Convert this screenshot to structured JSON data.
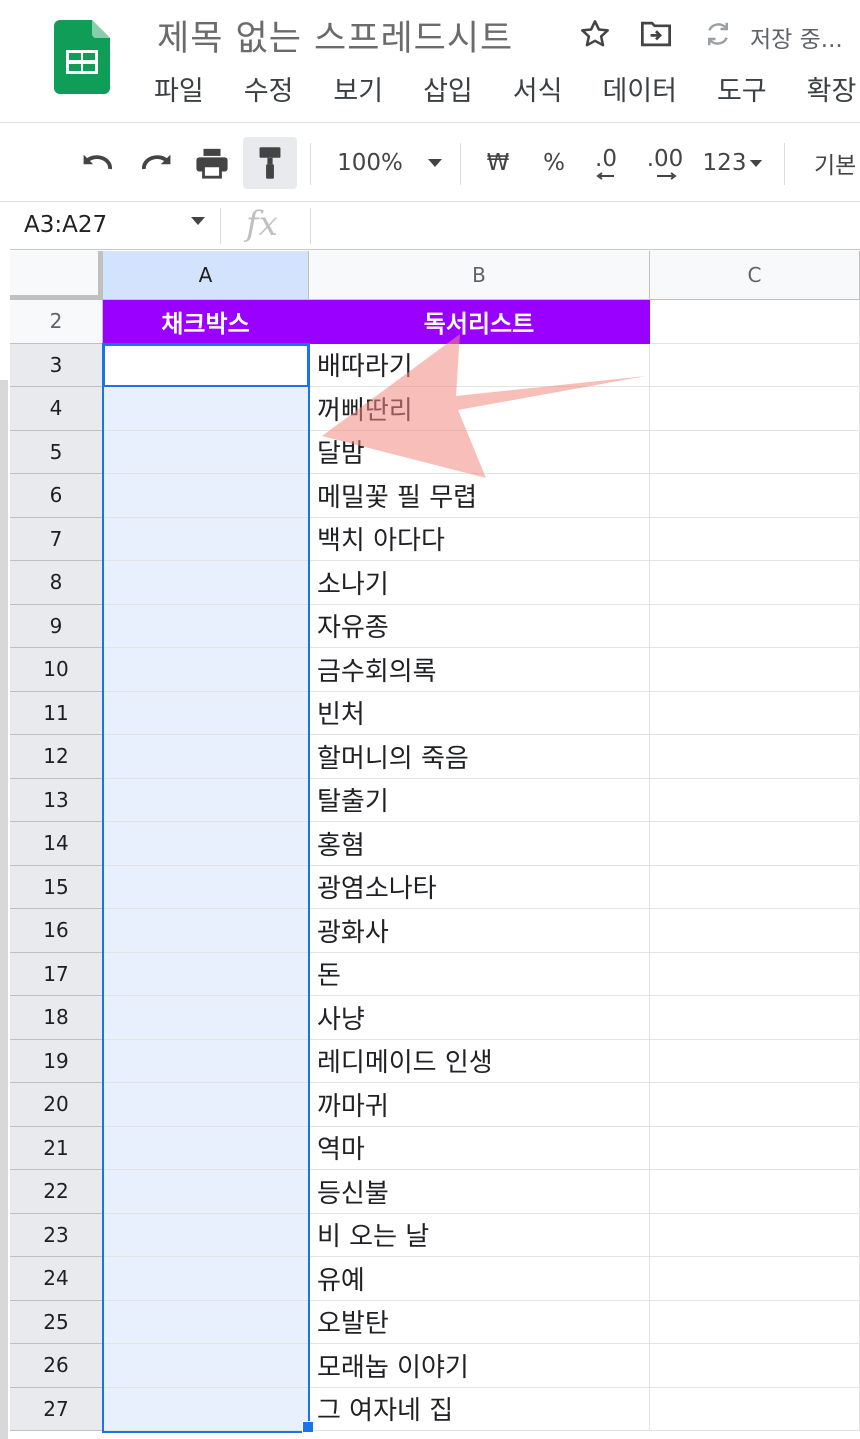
{
  "header": {
    "title": "제목 없는 스프레드시트",
    "save_status": "저장 중..."
  },
  "menu": [
    "파일",
    "수정",
    "보기",
    "삽입",
    "서식",
    "데이터",
    "도구",
    "확장 프"
  ],
  "toolbar": {
    "zoom": "100%",
    "currency": "₩",
    "percent": "%",
    "decrease_decimal": ".0",
    "increase_decimal": ".00",
    "more_formats": "123",
    "font_partial": "기본"
  },
  "formula_bar": {
    "name_box": "A3:A27",
    "fx": "fx"
  },
  "columns": [
    "A",
    "B",
    "C"
  ],
  "sheet": {
    "header_row": {
      "row": "2",
      "a": "채크박스",
      "b": "독서리스트"
    },
    "rows": [
      {
        "row": "3",
        "b": "배따라기"
      },
      {
        "row": "4",
        "b": "꺼삐딴리"
      },
      {
        "row": "5",
        "b": "달밤"
      },
      {
        "row": "6",
        "b": "메밀꽃 필 무렵"
      },
      {
        "row": "7",
        "b": "백치 아다다"
      },
      {
        "row": "8",
        "b": "소나기"
      },
      {
        "row": "9",
        "b": "자유종"
      },
      {
        "row": "10",
        "b": "금수회의록"
      },
      {
        "row": "11",
        "b": "빈처"
      },
      {
        "row": "12",
        "b": "할머니의 죽음"
      },
      {
        "row": "13",
        "b": "탈출기"
      },
      {
        "row": "14",
        "b": "홍혐"
      },
      {
        "row": "15",
        "b": "광염소나타"
      },
      {
        "row": "16",
        "b": "광화사"
      },
      {
        "row": "17",
        "b": "돈"
      },
      {
        "row": "18",
        "b": "사냥"
      },
      {
        "row": "19",
        "b": "레디메이드 인생"
      },
      {
        "row": "20",
        "b": "까마귀"
      },
      {
        "row": "21",
        "b": "역마"
      },
      {
        "row": "22",
        "b": "등신불"
      },
      {
        "row": "23",
        "b": "비 오는 날"
      },
      {
        "row": "24",
        "b": "유예"
      },
      {
        "row": "25",
        "b": "오발탄"
      },
      {
        "row": "26",
        "b": "모래놉 이야기"
      },
      {
        "row": "27",
        "b": "그 여자네 집"
      }
    ]
  },
  "colors": {
    "brand_green": "#0f9d58",
    "header_purple": "#9900ff",
    "selection_blue": "#1a73e8",
    "annotation_arrow": "#f28b82"
  },
  "icons": [
    "sheets-logo-icon",
    "star-icon",
    "move-to-folder-icon",
    "sync-icon",
    "undo-icon",
    "redo-icon",
    "print-icon",
    "paint-format-icon",
    "dropdown-arrow-icon",
    "fx-icon"
  ]
}
